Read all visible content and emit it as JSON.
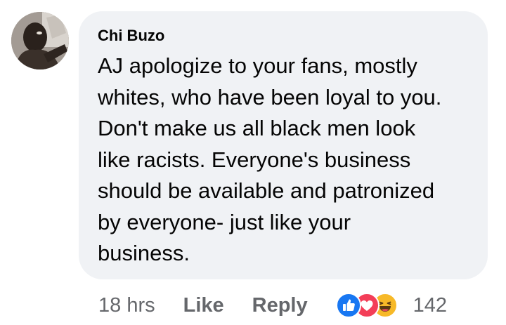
{
  "comment": {
    "author": "Chi Buzo",
    "text": "AJ apologize to your fans, mostly\nwhites, who have been loyal to you.\nDon't make us all black men look\nlike racists. Everyone's business\nshould be available and patronized\nby everyone- just like your\nbusiness."
  },
  "meta": {
    "time": "18 hrs",
    "like_label": "Like",
    "reply_label": "Reply",
    "reaction_count": "142"
  },
  "reactions": {
    "icons": [
      "like-icon",
      "love-icon",
      "haha-icon"
    ],
    "colors": {
      "like": "#1877f2",
      "love": "#f33e58",
      "haha": "#f7b928"
    }
  },
  "colors": {
    "bubble": "#f0f2f5",
    "text": "#050505",
    "secondary": "#65676b"
  }
}
